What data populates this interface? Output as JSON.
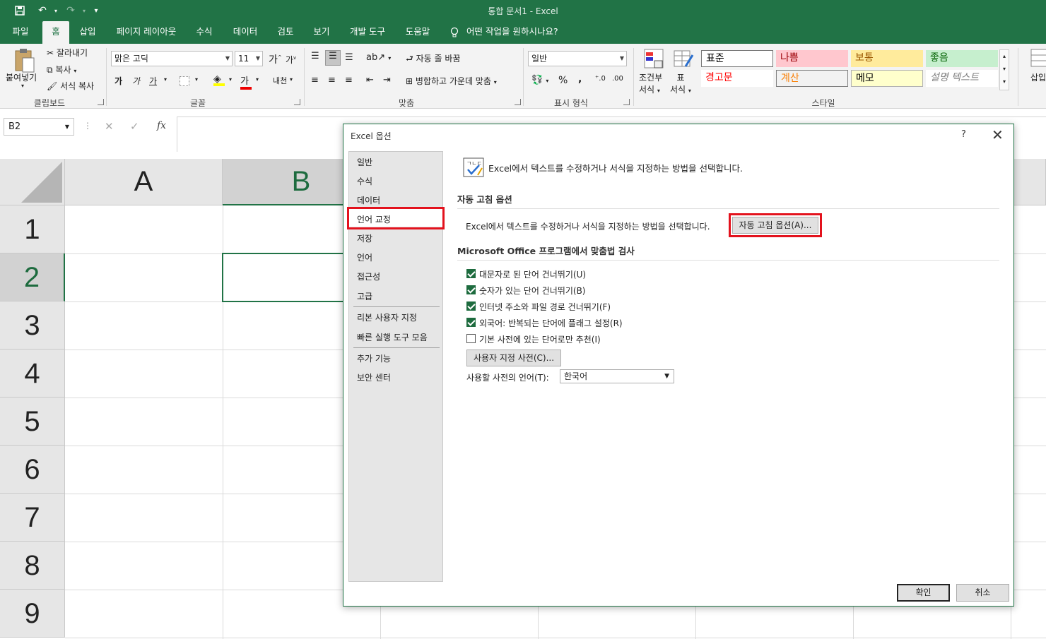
{
  "window": {
    "title": "통합 문서1  -  Excel"
  },
  "qat": {
    "save": "save-icon",
    "undo": "↶",
    "redo": "↷",
    "customize": "▾"
  },
  "menu_tabs": [
    "파일",
    "홈",
    "삽입",
    "페이지 레이아웃",
    "수식",
    "데이터",
    "검토",
    "보기",
    "개발 도구",
    "도움말"
  ],
  "tell_me": "어떤 작업을 원하시나요?",
  "ribbon": {
    "clipboard": {
      "paste": "붙여넣기",
      "cut": "잘라내기",
      "copy": "복사",
      "format_painter": "서식 복사",
      "label": "클립보드"
    },
    "font": {
      "name": "맑은 고딕",
      "size": "11",
      "bold": "가",
      "italic": "가",
      "underline": "가",
      "grow": "가",
      "shrink": "가",
      "phonetic": "내천",
      "label": "글꼴"
    },
    "alignment": {
      "wrap": "자동 줄 바꿈",
      "merge": "병합하고 가운데 맞춤",
      "label": "맞춤"
    },
    "number": {
      "format": "일반",
      "percent": "%",
      "comma": ",",
      "label": "표시 형식"
    },
    "styles": {
      "conditional": "조건부 서식",
      "conditional_l1": "조건부",
      "conditional_l2": "서식",
      "table": "표 서식",
      "table_l1": "표",
      "table_l2": "서식",
      "cells": [
        {
          "text": "표준",
          "bg": "#ffffff",
          "color": "#000000"
        },
        {
          "text": "나쁨",
          "bg": "#ffc7ce",
          "color": "#9c0006"
        },
        {
          "text": "보통",
          "bg": "#ffeb9c",
          "color": "#9c5700"
        },
        {
          "text": "좋음",
          "bg": "#c6efce",
          "color": "#006100"
        },
        {
          "text": "경고문",
          "bg": "#ffffff",
          "color": "#ff0000"
        },
        {
          "text": "계산",
          "bg": "#f2f2f2",
          "color": "#fa7d00"
        },
        {
          "text": "메모",
          "bg": "#ffffcc",
          "color": "#000000"
        },
        {
          "text": "설명 텍스트",
          "bg": "#ffffff",
          "color": "#7f7f7f"
        }
      ],
      "label": "스타일"
    },
    "insert": "삽입"
  },
  "formula_bar": {
    "name_box": "B2",
    "cancel": "✕",
    "enter": "✓",
    "fx": "fx"
  },
  "sheet": {
    "columns": [
      "A",
      "B"
    ],
    "rows": [
      "1",
      "2",
      "3",
      "4",
      "5",
      "6",
      "7",
      "8",
      "9"
    ],
    "selected_cell": "B2"
  },
  "dialog": {
    "title": "Excel 옵션",
    "help": "?",
    "close": "✕",
    "nav": [
      "일반",
      "수식",
      "데이터",
      "언어 교정",
      "저장",
      "언어",
      "접근성",
      "고급",
      "리본 사용자 지정",
      "빠른 실행 도구 모음",
      "추가 기능",
      "보안 센터"
    ],
    "active_nav": "언어 교정",
    "header": "Excel에서 텍스트를 수정하거나 서식을 지정하는 방법을 선택합니다.",
    "autocorrect": {
      "section": "자동 고침 옵션",
      "desc": "Excel에서 텍스트를 수정하거나 서식을 지정하는 방법을 선택합니다.",
      "button": "자동 고침 옵션(A)..."
    },
    "spelling": {
      "section": "Microsoft Office 프로그램에서 맞춤법 검사",
      "options": [
        {
          "label": "대문자로 된 단어 건너뛰기(U)",
          "checked": true
        },
        {
          "label": "숫자가 있는 단어 건너뛰기(B)",
          "checked": true
        },
        {
          "label": "인터넷 주소와 파일 경로 건너뛰기(F)",
          "checked": true
        },
        {
          "label": "외국어: 반복되는 단어에 플래그 설정(R)",
          "checked": true
        },
        {
          "label": "기본 사전에 있는 단어로만 추천(I)",
          "checked": false
        }
      ],
      "custom_dict_button": "사용자 지정 사전(C)...",
      "dict_lang_label": "사용할 사전의 언어(T):",
      "dict_lang_value": "한국어"
    },
    "ok": "확인",
    "cancel": "취소"
  },
  "colors": {
    "excel_green": "#217346",
    "highlight_red": "#e3121d"
  }
}
